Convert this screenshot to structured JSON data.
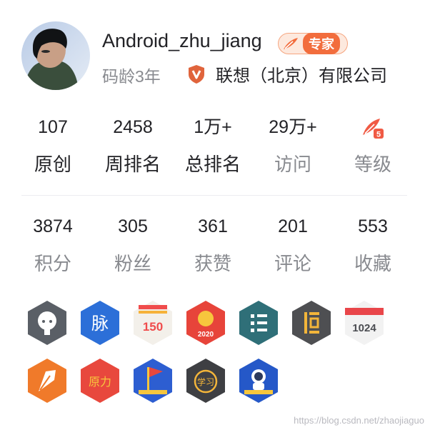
{
  "profile": {
    "username": "Android_zhu_jiang",
    "expert_label": "专家",
    "code_age": "码龄3年",
    "organization": "联想（北京）有限公司"
  },
  "stats_top": [
    {
      "value": "107",
      "label": "原创"
    },
    {
      "value": "2458",
      "label": "周排名"
    },
    {
      "value": "1万+",
      "label": "总排名"
    },
    {
      "value": "29万+",
      "label": "访问"
    },
    {
      "value": "",
      "label": "等级",
      "level_badge": "5"
    }
  ],
  "stats_bottom": [
    {
      "value": "3874",
      "label": "积分"
    },
    {
      "value": "305",
      "label": "粉丝"
    },
    {
      "value": "361",
      "label": "获赞"
    },
    {
      "value": "201",
      "label": "评论"
    },
    {
      "value": "553",
      "label": "收藏"
    }
  ],
  "badges": {
    "row1": [
      {
        "icon": "github-icon",
        "color": "#5a5f66"
      },
      {
        "icon": "mai-icon",
        "text": "脉",
        "color": "#2c6fd8"
      },
      {
        "icon": "150-badge-icon",
        "text": "150",
        "color": "#f04c4c"
      },
      {
        "icon": "2020-badge-icon",
        "text": "2020",
        "color": "#e7443a"
      },
      {
        "icon": "column-icon",
        "color": "#2f6f78"
      },
      {
        "icon": "persistence-icon",
        "color": "#4e4f52"
      },
      {
        "icon": "1024-calendar-icon",
        "text": "1024",
        "color": "#e9464a"
      }
    ],
    "row2": [
      {
        "icon": "fountain-pen-icon",
        "color": "#f07a2a"
      },
      {
        "icon": "yuanli-icon",
        "text": "原力",
        "color": "#e8483d"
      },
      {
        "icon": "flag-badge-icon",
        "color": "#2d5ed1"
      },
      {
        "icon": "study-badge-icon",
        "text": "学习",
        "color": "#3e3f43"
      },
      {
        "icon": "astronaut-badge-icon",
        "color": "#2558c8"
      }
    ]
  },
  "watermark": "https://blog.csdn.net/zhaojiaguo"
}
